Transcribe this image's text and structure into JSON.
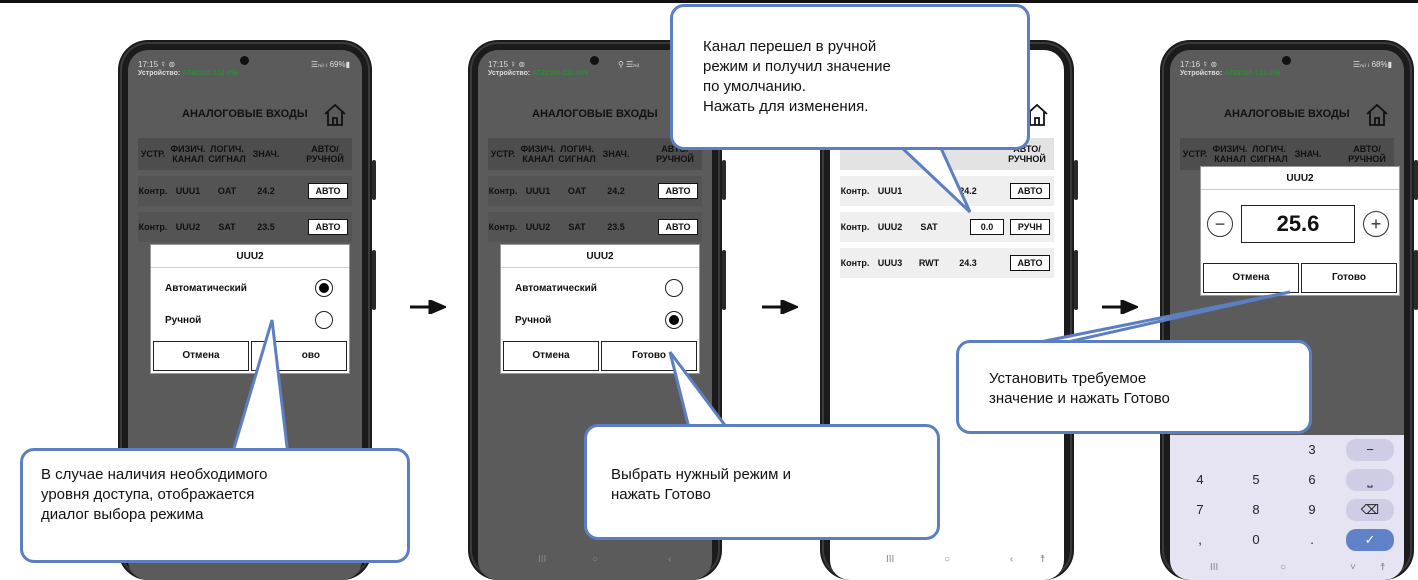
{
  "status": {
    "p1": {
      "time": "17:15 ☿ ⊚",
      "signal": "☰ₙᵢₗ ₗ 69%▮"
    },
    "p2": {
      "time": "17:15 ☿ ⊚",
      "signal": "⚲ ☰ₙᵢₗ"
    },
    "p4": {
      "time": "17:16 ☿ ⊚",
      "signal": "☰ₙᵢₗ ₗ 68%▮"
    },
    "device_label": "Устройство:",
    "device_id": "AT82100-132-056"
  },
  "page_title": "АНАЛОГОВЫЕ ВХОДЫ",
  "table": {
    "headers": {
      "dev": "УСТР.",
      "phys": "ФИЗИЧ.\nКАНАЛ",
      "log": "ЛОГИЧ.\nСИГНАЛ",
      "val": "ЗНАЧ.",
      "mode": "АВТО/\nРУЧНОЙ"
    },
    "rows_initial": [
      {
        "dev": "Контр.",
        "phys": "UUU1",
        "log": "OAT",
        "val": "24.2",
        "mode": "АВТО"
      },
      {
        "dev": "Контр.",
        "phys": "UUU2",
        "log": "SAT",
        "val": "23.5",
        "mode": "АВТО"
      }
    ],
    "rows_after": [
      {
        "dev": "Контр.",
        "phys": "UUU1",
        "log": "OAT",
        "val": "24.2",
        "mode": "АВТО"
      },
      {
        "dev": "Контр.",
        "phys": "UUU2",
        "log": "SAT",
        "val": "0.0",
        "mode": "РУЧН"
      },
      {
        "dev": "Контр.",
        "phys": "UUU3",
        "log": "RWT",
        "val": "24.3",
        "mode": "АВТО"
      }
    ]
  },
  "mode_dialog": {
    "title": "UUU2",
    "option_auto": "Автоматический",
    "option_manual": "Ручной",
    "cancel": "Отмена",
    "done": "Готово",
    "done_partial": "ово"
  },
  "value_dialog": {
    "title": "UUU2",
    "value": "25.6",
    "minus": "−",
    "plus": "+",
    "cancel": "Отмена",
    "done": "Готово"
  },
  "keypad": {
    "keys": [
      "3",
      "−",
      "4",
      "5",
      "6",
      "⎵",
      "7",
      "8",
      "9",
      "⌫",
      ",",
      "0",
      ".",
      "✓"
    ]
  },
  "callouts": {
    "c1": "В случае наличия необходимого\nуровня доступа, отображается\nдиалог выбора режима",
    "c2": "Выбрать нужный режим и\nнажать Готово",
    "c3": "Канал перешел в ручной\nрежим и получил значение\nпо умолчанию.\nНажать для изменения.",
    "c4": "Установить требуемое\nзначение и нажать Готово"
  },
  "arrow_glyph": "→",
  "colors": {
    "callout_border": "#5b7fc0",
    "device_id": "#2e8b3a",
    "ok_key": "#5f82c9"
  }
}
